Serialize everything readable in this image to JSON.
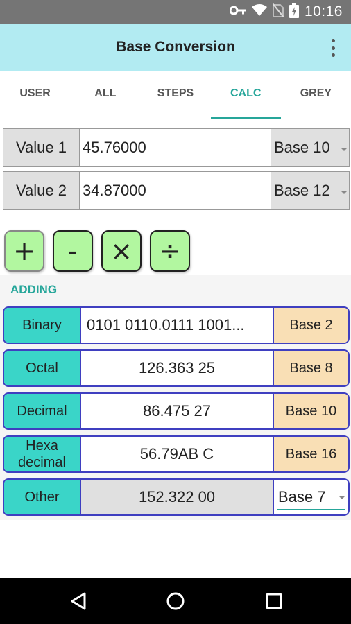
{
  "status_bar": {
    "time": "10:16",
    "icons": [
      "key-icon",
      "wifi-icon",
      "no-sim-icon",
      "battery-charging-icon"
    ]
  },
  "app_bar": {
    "title": "Base Conversion",
    "overflow_icon": "more-vert-icon"
  },
  "tabs": [
    {
      "label": "USER",
      "active": false
    },
    {
      "label": "ALL",
      "active": false
    },
    {
      "label": "STEPS",
      "active": false
    },
    {
      "label": "CALC",
      "active": true
    },
    {
      "label": "GREY",
      "active": false
    }
  ],
  "inputs": [
    {
      "label": "Value 1",
      "value": "45.76000",
      "base": "Base 10"
    },
    {
      "label": "Value 2",
      "value": "34.87000",
      "base": "Base 12"
    }
  ],
  "operations": [
    "+",
    "-",
    "×",
    "÷"
  ],
  "section_title": "ADDING",
  "results": [
    {
      "label": "Binary",
      "value": "0101 0110.0111 1001...",
      "base": "Base 2"
    },
    {
      "label": "Octal",
      "value": "126.363 25",
      "base": "Base 8"
    },
    {
      "label": "Decimal",
      "value": "86.475 27",
      "base": "Base 10"
    },
    {
      "label": "Hexa decimal",
      "label_line1": "Hexa",
      "label_line2": "decimal",
      "value": "56.79AB C",
      "base": "Base 16"
    },
    {
      "label": "Other",
      "value": "152.322 00",
      "base": "Base 7"
    }
  ],
  "colors": {
    "status_bar": "#757575",
    "app_bar": "#b2ebf2",
    "accent": "#26a69a",
    "op_button": "#b2f7a0",
    "result_label": "#3ad5c8",
    "result_base": "#f9dfb5",
    "result_border": "#3f3fc0"
  },
  "nav_bar": {
    "buttons": [
      "back-icon",
      "home-icon",
      "recents-icon"
    ]
  }
}
